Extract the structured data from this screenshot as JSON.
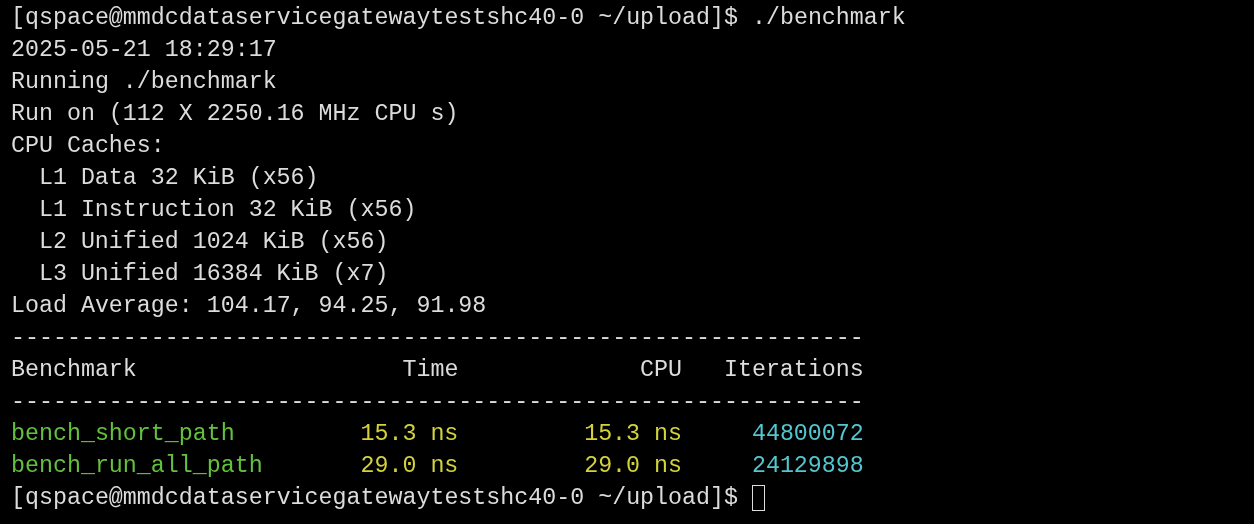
{
  "terminal": {
    "command": {
      "prompt": "[qspace@mmdcdataservicegatewaytestshc40-0 ~/upload]$",
      "input": "./benchmark"
    },
    "header_lines": [
      "2025-05-21 18:29:17",
      "Running ./benchmark",
      "Run on (112 X 2250.16 MHz CPU s)"
    ],
    "cpu_caches": {
      "label": "CPU Caches:",
      "items": [
        "L1 Data 32 KiB (x56)",
        "L1 Instruction 32 KiB (x56)",
        "L2 Unified 1024 KiB (x56)",
        "L3 Unified 16384 KiB (x7)"
      ]
    },
    "load_average": "Load Average: 104.17, 94.25, 91.98",
    "separator": "-------------------------------------------------------------",
    "table": {
      "columns": [
        "Benchmark",
        "Time",
        "CPU",
        "Iterations"
      ],
      "rows": [
        {
          "name": "bench_short_path",
          "time": "15.3 ns",
          "cpu": "15.3 ns",
          "iterations": "44800072"
        },
        {
          "name": "bench_run_all_path",
          "time": "29.0 ns",
          "cpu": "29.0 ns",
          "iterations": "24129898"
        }
      ]
    },
    "next_prompt": {
      "prompt": "[qspace@mmdcdataservicegatewaytestshc40-0 ~/upload]$",
      "cursor": true
    }
  }
}
